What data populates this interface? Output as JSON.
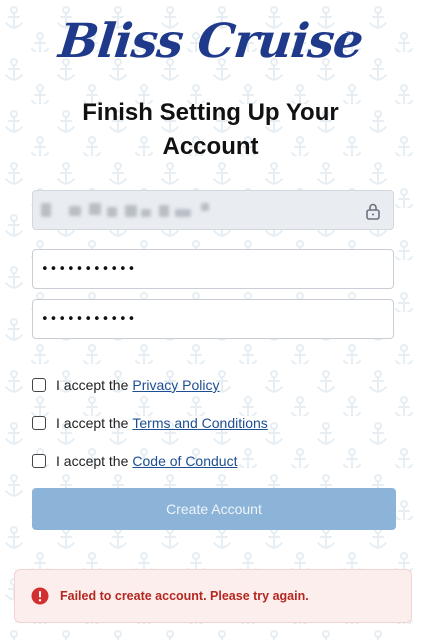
{
  "brand": {
    "name": "Bliss Cruise",
    "trademark": "™",
    "color": "#1f3a8a"
  },
  "page": {
    "title_line1": "Finish Setting Up Your",
    "title_line2": "Account"
  },
  "form": {
    "email_value_redacted": true,
    "password_value": "•••••••••••",
    "confirm_password_value": "•••••••••••",
    "checkboxes": [
      {
        "prefix": "I accept the",
        "link_text": "Privacy Policy",
        "checked": false
      },
      {
        "prefix": "I accept the",
        "link_text": "Terms and Conditions",
        "checked": false
      },
      {
        "prefix": "I accept the",
        "link_text": "Code of Conduct",
        "checked": false
      }
    ],
    "submit_label": "Create Account",
    "submit_disabled": true
  },
  "alert": {
    "message": "Failed to create account. Please try again.",
    "severity": "error"
  },
  "colors": {
    "button_disabled": "#8cb4d8",
    "link": "#1d4f91",
    "error_text": "#b4271f",
    "error_bg": "#fdeeee"
  }
}
